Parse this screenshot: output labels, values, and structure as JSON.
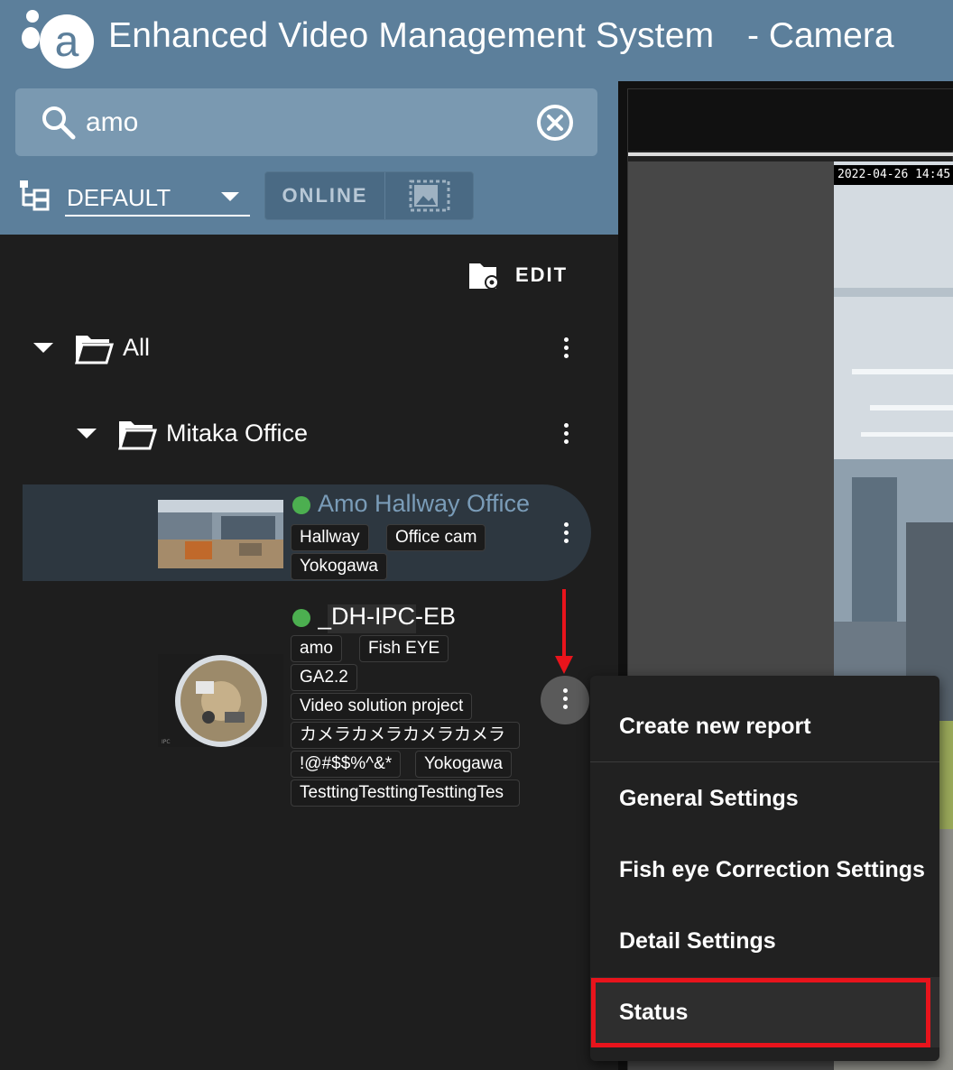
{
  "header": {
    "title": "Enhanced Video Management System",
    "suffix": "- Camera"
  },
  "search": {
    "value": "amo"
  },
  "toolbar": {
    "group_select_value": "DEFAULT",
    "online_label": "ONLINE"
  },
  "list": {
    "edit_label": "EDIT",
    "folders": [
      {
        "label": "All"
      },
      {
        "label": "Mitaka Office"
      }
    ],
    "cameras": [
      {
        "name": "Amo Hallway Office",
        "status_color": "#4caf50",
        "selected": true,
        "tags": [
          "Hallway",
          "Office cam",
          "Yokogawa"
        ]
      },
      {
        "name": "_DH-IPC-EB",
        "status_color": "#4caf50",
        "selected": false,
        "tags": [
          "amo",
          "Fish EYE",
          "GA2.2",
          "Video solution project",
          "カメラカメラカメラカメラ",
          "!@#$$%^&*",
          "Yokogawa",
          "TesttingTesttingTesttingTes"
        ]
      }
    ]
  },
  "video": {
    "timestamp": "2022-04-26 14:45"
  },
  "context_menu": {
    "items": [
      "Create new report",
      "General Settings",
      "Fish eye Correction Settings",
      "Detail Settings",
      "Status"
    ],
    "highlighted": "Status"
  },
  "colors": {
    "header_bg": "#5c7f9b",
    "panel_bg": "#1e1e1e",
    "selected_row_bg": "#2d3740",
    "selected_name": "#7a9cb8",
    "status_green": "#4caf50",
    "highlight_red": "#e8141c"
  }
}
